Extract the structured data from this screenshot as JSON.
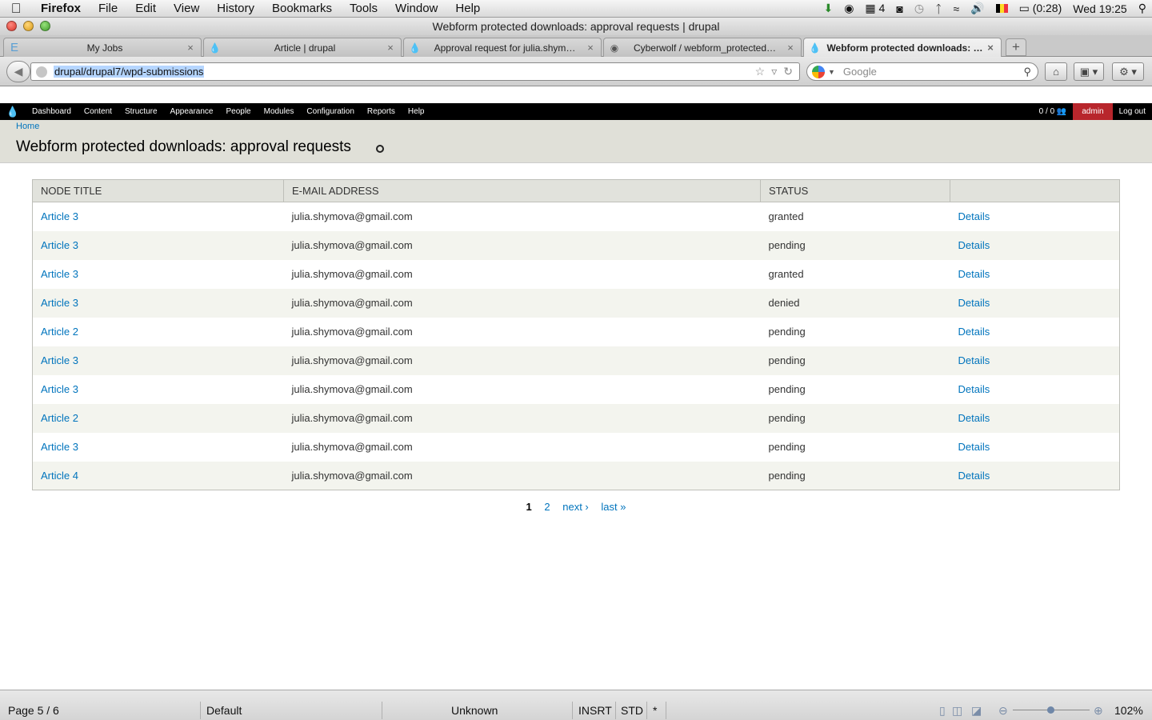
{
  "menubar": {
    "app": "Firefox",
    "items": [
      "File",
      "Edit",
      "View",
      "History",
      "Bookmarks",
      "Tools",
      "Window",
      "Help"
    ],
    "right": {
      "notes": "4",
      "battery": "(0:28)",
      "clock": "Wed 19:25"
    }
  },
  "window": {
    "title": "Webform protected downloads: approval requests | drupal"
  },
  "tabs": [
    {
      "label": "My Jobs",
      "icon": "E"
    },
    {
      "label": "Article | drupal",
      "icon": "drupal"
    },
    {
      "label": "Approval request for julia.shym…",
      "icon": "drupal"
    },
    {
      "label": "Cyberwolf / webform_protected…",
      "icon": "github"
    },
    {
      "label": "Webform protected downloads: …",
      "icon": "drupal"
    }
  ],
  "nav": {
    "url": "drupal/drupal7/wpd-submissions",
    "search_placeholder": "Google"
  },
  "toolbar": {
    "items": [
      "Dashboard",
      "Content",
      "Structure",
      "Appearance",
      "People",
      "Modules",
      "Configuration",
      "Reports",
      "Help"
    ],
    "shortcut_count": "0 / 0",
    "user": "admin",
    "logout": "Log out"
  },
  "page": {
    "breadcrumb": "Home",
    "title": "Webform protected downloads: approval requests"
  },
  "table": {
    "headers": [
      "NODE TITLE",
      "E-MAIL ADDRESS",
      "STATUS",
      ""
    ],
    "rows": [
      {
        "title": "Article 3",
        "email": "julia.shymova@gmail.com",
        "status": "granted",
        "action": "Details"
      },
      {
        "title": "Article 3",
        "email": "julia.shymova@gmail.com",
        "status": "pending",
        "action": "Details"
      },
      {
        "title": "Article 3",
        "email": "julia.shymova@gmail.com",
        "status": "granted",
        "action": "Details"
      },
      {
        "title": "Article 3",
        "email": "julia.shymova@gmail.com",
        "status": "denied",
        "action": "Details"
      },
      {
        "title": "Article 2",
        "email": "julia.shymova@gmail.com",
        "status": "pending",
        "action": "Details"
      },
      {
        "title": "Article 3",
        "email": "julia.shymova@gmail.com",
        "status": "pending",
        "action": "Details"
      },
      {
        "title": "Article 3",
        "email": "julia.shymova@gmail.com",
        "status": "pending",
        "action": "Details"
      },
      {
        "title": "Article 2",
        "email": "julia.shymova@gmail.com",
        "status": "pending",
        "action": "Details"
      },
      {
        "title": "Article 3",
        "email": "julia.shymova@gmail.com",
        "status": "pending",
        "action": "Details"
      },
      {
        "title": "Article 4",
        "email": "julia.shymova@gmail.com",
        "status": "pending",
        "action": "Details"
      }
    ]
  },
  "pager": {
    "current": "1",
    "page2": "2",
    "next": "next ›",
    "last": "last »"
  },
  "statusbar": {
    "page": "Page 5 / 6",
    "style": "Default",
    "language": "Unknown",
    "insert_mode": "INSRT",
    "selection_mode": "STD",
    "modified": "*",
    "zoom": "102%"
  }
}
